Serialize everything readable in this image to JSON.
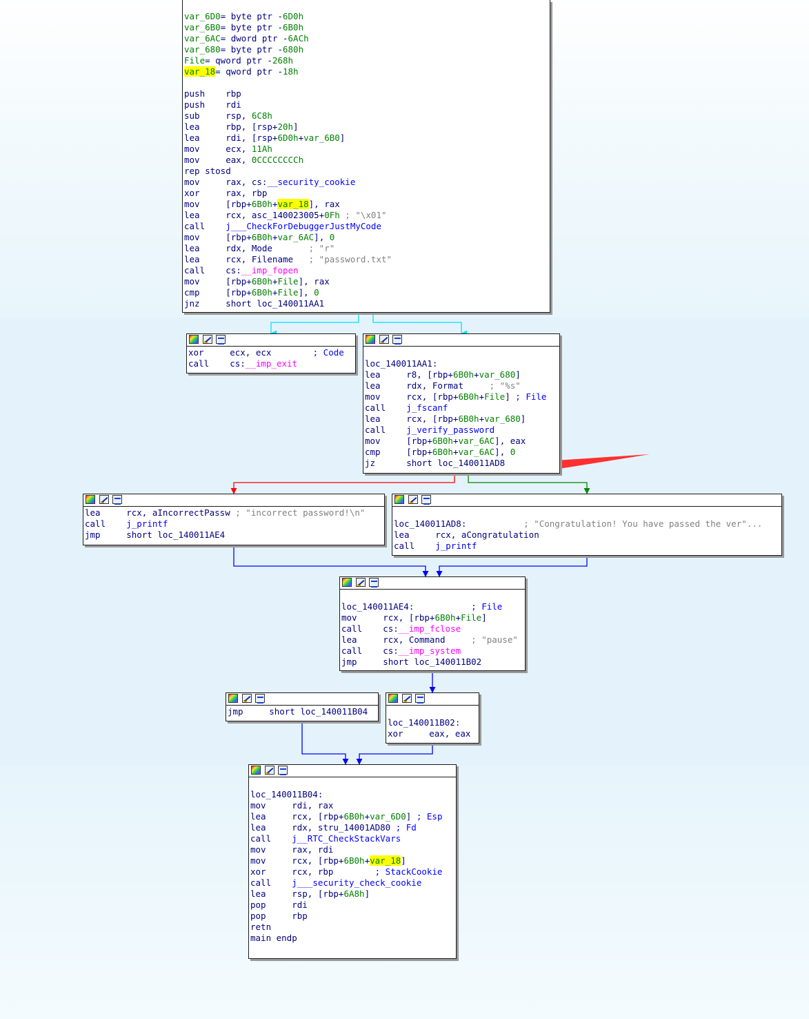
{
  "colors": {
    "edge_true": "#00aa00",
    "edge_false": "#ff0000",
    "edge_unconditional": "#0000ff",
    "edge_cyan": "#00e0ff",
    "annotation_arrow": "#ff3030",
    "highlight": "#ffff00"
  },
  "icons": [
    "node-color-icon",
    "node-edit-icon",
    "node-graph-icon"
  ],
  "blocks": {
    "main": {
      "lines": [
        [
          [
            "var_6D0",
            "var"
          ],
          [
            "= byte ptr -",
            "kw"
          ],
          [
            "6D0h",
            "num"
          ]
        ],
        [
          [
            "var_6B0",
            "var"
          ],
          [
            "= byte ptr -",
            "kw"
          ],
          [
            "6B0h",
            "num"
          ]
        ],
        [
          [
            "var_6AC",
            "var"
          ],
          [
            "= dword ptr -",
            "kw"
          ],
          [
            "6ACh",
            "num"
          ]
        ],
        [
          [
            "var_680",
            "var"
          ],
          [
            "= byte ptr -",
            "kw"
          ],
          [
            "680h",
            "num"
          ]
        ],
        [
          [
            "File",
            "var"
          ],
          [
            "= qword ptr -",
            "kw"
          ],
          [
            "268h",
            "num"
          ]
        ],
        [
          [
            "var_18",
            "hl"
          ],
          [
            "= qword ptr -",
            "kw"
          ],
          [
            "18h",
            "num"
          ]
        ],
        [],
        [
          [
            "push    rbp",
            "kw"
          ]
        ],
        [
          [
            "push    rdi",
            "kw"
          ]
        ],
        [
          [
            "sub     rsp, ",
            "kw"
          ],
          [
            "6C8h",
            "num"
          ]
        ],
        [
          [
            "lea     rbp, [rsp+",
            "kw"
          ],
          [
            "20h",
            "num"
          ],
          [
            "]",
            "kw"
          ]
        ],
        [
          [
            "lea     rdi, [rsp+",
            "kw"
          ],
          [
            "6D0h",
            "num"
          ],
          [
            "+",
            "kw"
          ],
          [
            "var_6B0",
            "var"
          ],
          [
            "]",
            "kw"
          ]
        ],
        [
          [
            "mov     ecx, ",
            "kw"
          ],
          [
            "11Ah",
            "num"
          ]
        ],
        [
          [
            "mov     eax, ",
            "kw"
          ],
          [
            "0CCCCCCCCh",
            "num"
          ]
        ],
        [
          [
            "rep stosd",
            "kw"
          ]
        ],
        [
          [
            "mov     rax, cs:",
            "kw"
          ],
          [
            "__security_cookie",
            "fn"
          ]
        ],
        [
          [
            "xor     rax, rbp",
            "kw"
          ]
        ],
        [
          [
            "mov     [rbp+",
            "kw"
          ],
          [
            "6B0h",
            "num"
          ],
          [
            "+",
            "kw"
          ],
          [
            "var_18",
            "hl"
          ],
          [
            "], rax",
            "kw"
          ]
        ],
        [
          [
            "lea     rcx, asc_140023005+",
            "kw"
          ],
          [
            "0Fh",
            "num"
          ],
          [
            " ; \"\\x01\"",
            "cmt"
          ]
        ],
        [
          [
            "call    ",
            "kw"
          ],
          [
            "j___CheckForDebuggerJustMyCode",
            "fn"
          ]
        ],
        [
          [
            "mov     [rbp+",
            "kw"
          ],
          [
            "6B0h",
            "num"
          ],
          [
            "+",
            "kw"
          ],
          [
            "var_6AC",
            "var"
          ],
          [
            "], ",
            "kw"
          ],
          [
            "0",
            "num"
          ]
        ],
        [
          [
            "lea     rdx, Mode       ",
            "kw"
          ],
          [
            "; \"r\"",
            "cmt"
          ]
        ],
        [
          [
            "lea     rcx, Filename   ",
            "kw"
          ],
          [
            "; \"password.txt\"",
            "cmt"
          ]
        ],
        [
          [
            "call    cs:",
            "kw"
          ],
          [
            "__imp_fopen",
            "imp"
          ]
        ],
        [
          [
            "mov     [rbp+",
            "kw"
          ],
          [
            "6B0h",
            "num"
          ],
          [
            "+",
            "kw"
          ],
          [
            "File",
            "var"
          ],
          [
            "], rax",
            "kw"
          ]
        ],
        [
          [
            "cmp     [rbp+",
            "kw"
          ],
          [
            "6B0h",
            "num"
          ],
          [
            "+",
            "kw"
          ],
          [
            "File",
            "var"
          ],
          [
            "], ",
            "kw"
          ],
          [
            "0",
            "num"
          ]
        ],
        [
          [
            "jnz     short loc_140011AA1",
            "kw"
          ]
        ]
      ]
    },
    "exit": {
      "lines": [
        [
          [
            "xor     ecx, ecx        ",
            "kw"
          ],
          [
            "; Code",
            "cmtb"
          ]
        ],
        [
          [
            "call    cs:",
            "kw"
          ],
          [
            "__imp_exit",
            "imp"
          ]
        ]
      ]
    },
    "aa1": {
      "lines": [
        [],
        [
          [
            "loc_140011AA1:",
            "kw"
          ]
        ],
        [
          [
            "lea     r8, [rbp+",
            "kw"
          ],
          [
            "6B0h",
            "num"
          ],
          [
            "+",
            "kw"
          ],
          [
            "var_680",
            "var"
          ],
          [
            "]",
            "kw"
          ]
        ],
        [
          [
            "lea     rdx, Format     ",
            "kw"
          ],
          [
            "; \"%s\"",
            "cmt"
          ]
        ],
        [
          [
            "mov     rcx, [rbp+",
            "kw"
          ],
          [
            "6B0h",
            "num"
          ],
          [
            "+",
            "kw"
          ],
          [
            "File",
            "var"
          ],
          [
            "] ",
            "kw"
          ],
          [
            "; File",
            "cmtb"
          ]
        ],
        [
          [
            "call    ",
            "kw"
          ],
          [
            "j_fscanf",
            "fn"
          ]
        ],
        [
          [
            "lea     rcx, [rbp+",
            "kw"
          ],
          [
            "6B0h",
            "num"
          ],
          [
            "+",
            "kw"
          ],
          [
            "var_680",
            "var"
          ],
          [
            "]",
            "kw"
          ]
        ],
        [
          [
            "call    ",
            "kw"
          ],
          [
            "j_verify_password",
            "fn"
          ]
        ],
        [
          [
            "mov     [rbp+",
            "kw"
          ],
          [
            "6B0h",
            "num"
          ],
          [
            "+",
            "kw"
          ],
          [
            "var_6AC",
            "var"
          ],
          [
            "], eax",
            "kw"
          ]
        ],
        [
          [
            "cmp     [rbp+",
            "kw"
          ],
          [
            "6B0h",
            "num"
          ],
          [
            "+",
            "kw"
          ],
          [
            "var_6AC",
            "var"
          ],
          [
            "], ",
            "kw"
          ],
          [
            "0",
            "num"
          ]
        ],
        [
          [
            "jz      short loc_140011AD8",
            "kw"
          ]
        ]
      ]
    },
    "incorrect": {
      "lines": [
        [
          [
            "lea     rcx, aIncorrectPassw ",
            "kw"
          ],
          [
            "; \"incorrect password!\\n\"",
            "cmt"
          ]
        ],
        [
          [
            "call    ",
            "kw"
          ],
          [
            "j_printf",
            "fn"
          ]
        ],
        [
          [
            "jmp     short loc_140011AE4",
            "kw"
          ]
        ]
      ]
    },
    "ad8": {
      "lines": [
        [],
        [
          [
            "loc_140011AD8:           ",
            "kw"
          ],
          [
            "; \"Congratulation! You have passed the ver\"...",
            "cmt"
          ]
        ],
        [
          [
            "lea     rcx, aCongratulation",
            "kw"
          ]
        ],
        [
          [
            "call    ",
            "kw"
          ],
          [
            "j_printf",
            "fn"
          ]
        ]
      ]
    },
    "ae4": {
      "lines": [
        [],
        [
          [
            "loc_140011AE4:           ",
            "kw"
          ],
          [
            "; File",
            "cmtb"
          ]
        ],
        [
          [
            "mov     rcx, [rbp+",
            "kw"
          ],
          [
            "6B0h",
            "num"
          ],
          [
            "+",
            "kw"
          ],
          [
            "File",
            "var"
          ],
          [
            "]",
            "kw"
          ]
        ],
        [
          [
            "call    cs:",
            "kw"
          ],
          [
            "__imp_fclose",
            "imp"
          ]
        ],
        [
          [
            "lea     rcx, Command     ",
            "kw"
          ],
          [
            "; \"pause\"",
            "cmt"
          ]
        ],
        [
          [
            "call    cs:",
            "kw"
          ],
          [
            "__imp_system",
            "imp"
          ]
        ],
        [
          [
            "jmp     short loc_140011B02",
            "kw"
          ]
        ]
      ]
    },
    "jmpb04": {
      "lines": [
        [
          [
            "jmp     short loc_140011B04",
            "kw"
          ]
        ]
      ]
    },
    "b02": {
      "lines": [
        [],
        [
          [
            "loc_140011B02:",
            "kw"
          ]
        ],
        [
          [
            "xor     eax, eax",
            "kw"
          ]
        ]
      ]
    },
    "b04": {
      "lines": [
        [],
        [
          [
            "loc_140011B04:",
            "kw"
          ]
        ],
        [
          [
            "mov     rdi, rax",
            "kw"
          ]
        ],
        [
          [
            "lea     rcx, [rbp+",
            "kw"
          ],
          [
            "6B0h",
            "num"
          ],
          [
            "+",
            "kw"
          ],
          [
            "var_6D0",
            "var"
          ],
          [
            "] ",
            "kw"
          ],
          [
            "; Esp",
            "cmtb"
          ]
        ],
        [
          [
            "lea     rdx, stru_14001AD80 ",
            "kw"
          ],
          [
            "; Fd",
            "cmtb"
          ]
        ],
        [
          [
            "call    ",
            "kw"
          ],
          [
            "j__RTC_CheckStackVars",
            "fn"
          ]
        ],
        [
          [
            "mov     rax, rdi",
            "kw"
          ]
        ],
        [
          [
            "mov     rcx, [rbp+",
            "kw"
          ],
          [
            "6B0h",
            "num"
          ],
          [
            "+",
            "kw"
          ],
          [
            "var_18",
            "hl"
          ],
          [
            "]",
            "kw"
          ]
        ],
        [
          [
            "xor     rcx, rbp        ",
            "kw"
          ],
          [
            "; StackCookie",
            "cmtb"
          ]
        ],
        [
          [
            "call    ",
            "kw"
          ],
          [
            "j___security_check_cookie",
            "fn"
          ]
        ],
        [
          [
            "lea     rsp, [rbp+",
            "kw"
          ],
          [
            "6A8h",
            "num"
          ],
          [
            "]",
            "kw"
          ]
        ],
        [
          [
            "pop     rdi",
            "kw"
          ]
        ],
        [
          [
            "pop     rbp",
            "kw"
          ]
        ],
        [
          [
            "retn",
            "kw"
          ]
        ],
        [
          [
            "main endp",
            "kw"
          ]
        ]
      ]
    }
  }
}
